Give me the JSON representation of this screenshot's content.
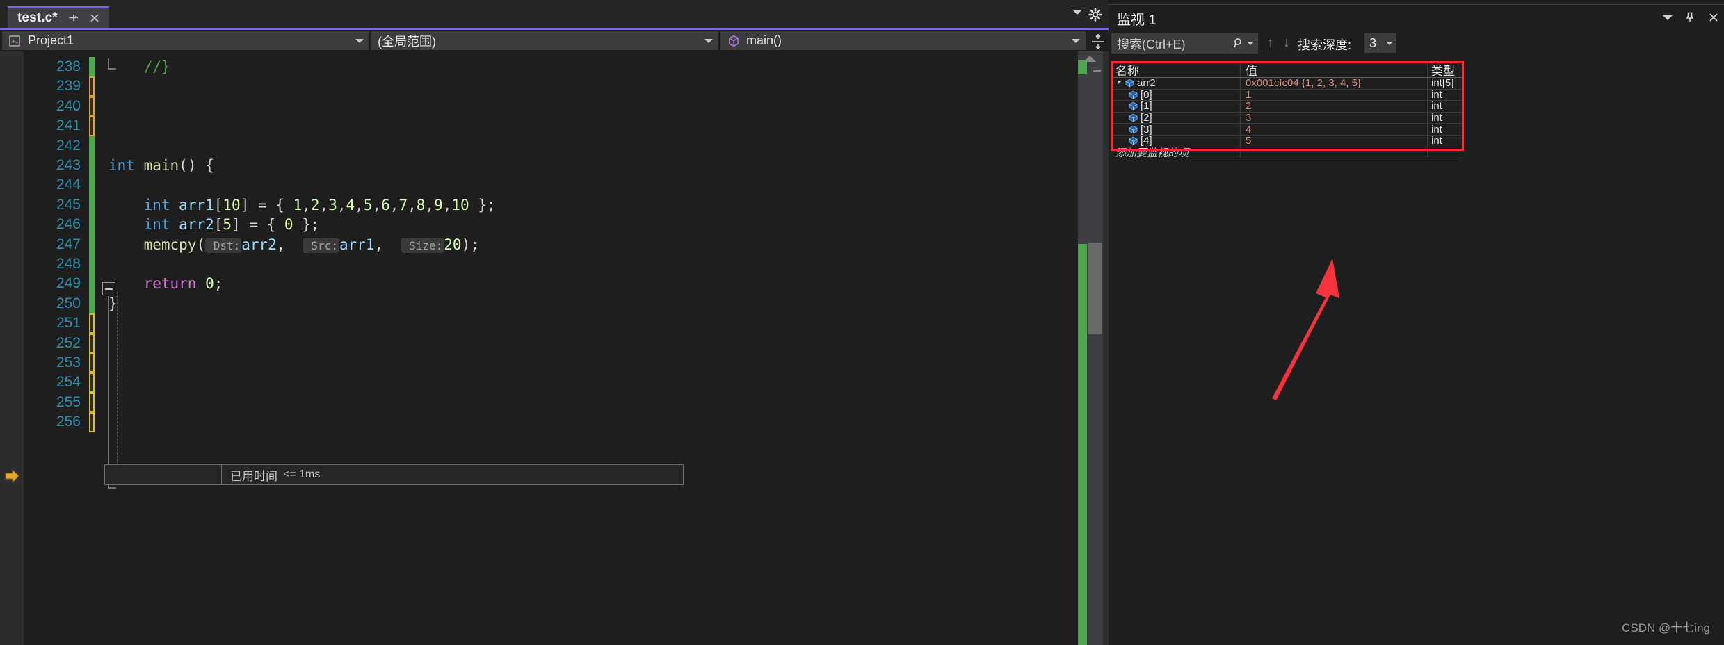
{
  "editor": {
    "tab": {
      "title": "test.c*",
      "pin_icon": "pin-icon",
      "close_icon": "close-icon"
    },
    "tabstrip": {
      "caret_icon": "chevron-down-icon",
      "gear_icon": "gear-icon"
    },
    "nav": {
      "project": "Project1",
      "project_icon": "cpp-project-icon",
      "scope": "(全局范围)",
      "member": "main()",
      "member_icon": "method-cube-icon",
      "split_icon": "split-view-icon",
      "caret_icon": "chevron-down-icon"
    },
    "first_line_number": 238,
    "last_line_number": 256,
    "lines": [
      {
        "n": 238,
        "change": "green",
        "segments": [
          {
            "t": "    //}",
            "c": "c-cm"
          }
        ]
      },
      {
        "n": 239,
        "change": "orange",
        "segments": []
      },
      {
        "n": 240,
        "change": "orange",
        "segments": []
      },
      {
        "n": 241,
        "change": "orange",
        "segments": []
      },
      {
        "n": 242,
        "change": "green",
        "segments": []
      },
      {
        "n": 243,
        "change": "green",
        "segments": [
          {
            "t": "int",
            "c": "c-kw"
          },
          {
            "t": " ",
            "c": "c-punc"
          },
          {
            "t": "main",
            "c": "c-fn"
          },
          {
            "t": "() {",
            "c": "c-punc"
          }
        ]
      },
      {
        "n": 244,
        "change": "green",
        "segments": []
      },
      {
        "n": 245,
        "change": "green",
        "segments": [
          {
            "t": "    int",
            "c": "c-kw"
          },
          {
            "t": " ",
            "c": "c-punc"
          },
          {
            "t": "arr1",
            "c": "c-id"
          },
          {
            "t": "[",
            "c": "c-brk"
          },
          {
            "t": "10",
            "c": "c-num"
          },
          {
            "t": "] = { ",
            "c": "c-brk"
          },
          {
            "t": "1",
            "c": "c-num"
          },
          {
            "t": ",",
            "c": "c-punc"
          },
          {
            "t": "2",
            "c": "c-num"
          },
          {
            "t": ",",
            "c": "c-punc"
          },
          {
            "t": "3",
            "c": "c-num"
          },
          {
            "t": ",",
            "c": "c-punc"
          },
          {
            "t": "4",
            "c": "c-num"
          },
          {
            "t": ",",
            "c": "c-punc"
          },
          {
            "t": "5",
            "c": "c-num"
          },
          {
            "t": ",",
            "c": "c-punc"
          },
          {
            "t": "6",
            "c": "c-num"
          },
          {
            "t": ",",
            "c": "c-punc"
          },
          {
            "t": "7",
            "c": "c-num"
          },
          {
            "t": ",",
            "c": "c-punc"
          },
          {
            "t": "8",
            "c": "c-num"
          },
          {
            "t": ",",
            "c": "c-punc"
          },
          {
            "t": "9",
            "c": "c-num"
          },
          {
            "t": ",",
            "c": "c-punc"
          },
          {
            "t": "10",
            "c": "c-num"
          },
          {
            "t": " };",
            "c": "c-brk"
          }
        ]
      },
      {
        "n": 246,
        "change": "green",
        "segments": [
          {
            "t": "    int",
            "c": "c-kw"
          },
          {
            "t": " ",
            "c": "c-punc"
          },
          {
            "t": "arr2",
            "c": "c-id"
          },
          {
            "t": "[",
            "c": "c-brk"
          },
          {
            "t": "5",
            "c": "c-num"
          },
          {
            "t": "] = { ",
            "c": "c-brk"
          },
          {
            "t": "0",
            "c": "c-num"
          },
          {
            "t": " };",
            "c": "c-brk"
          }
        ]
      },
      {
        "n": 247,
        "change": "green",
        "segments": [
          {
            "t": "    memcpy",
            "c": "c-fn"
          },
          {
            "t": "(",
            "c": "c-punc"
          },
          {
            "t": "_Dst:",
            "c": "hint"
          },
          {
            "t": "arr2",
            "c": "c-id"
          },
          {
            "t": ",  ",
            "c": "c-punc"
          },
          {
            "t": "_Src:",
            "c": "hint"
          },
          {
            "t": "arr1",
            "c": "c-id"
          },
          {
            "t": ",  ",
            "c": "c-punc"
          },
          {
            "t": "_Size:",
            "c": "hint"
          },
          {
            "t": "20",
            "c": "c-num"
          },
          {
            "t": ");",
            "c": "c-punc"
          }
        ]
      },
      {
        "n": 248,
        "change": "green",
        "segments": []
      },
      {
        "n": 249,
        "change": "green",
        "current": true,
        "segments": [
          {
            "t": "    return",
            "c": "c-ret"
          },
          {
            "t": " ",
            "c": "c-punc"
          },
          {
            "t": "0",
            "c": "c-num"
          },
          {
            "t": ";",
            "c": "c-punc"
          }
        ]
      },
      {
        "n": 250,
        "change": "green",
        "segments": [
          {
            "t": "}",
            "c": "c-punc"
          }
        ]
      },
      {
        "n": 251,
        "change": "yellow",
        "segments": []
      },
      {
        "n": 252,
        "change": "yellow",
        "segments": []
      },
      {
        "n": 253,
        "change": "yellow",
        "segments": []
      },
      {
        "n": 254,
        "change": "yellow",
        "segments": []
      },
      {
        "n": 255,
        "change": "yellow",
        "segments": []
      },
      {
        "n": 256,
        "change": "yellow",
        "segments": []
      }
    ],
    "elapsed_label": "已用时间",
    "elapsed_value": "<= 1ms",
    "exec_arrow_icon": "current-statement-arrow-icon",
    "scrollbar": {
      "up_icon": "scroll-up-arrow-icon"
    }
  },
  "watch": {
    "title": "监视 1",
    "caret_icon": "chevron-down-icon",
    "pin_icon": "pin-icon",
    "close_icon": "close-icon",
    "search_placeholder": "搜索(Ctrl+E)",
    "search_icon": "search-icon",
    "prev_icon": "arrow-up-icon",
    "next_icon": "arrow-down-icon",
    "depth_label": "搜索深度:",
    "depth_value": "3",
    "columns": {
      "name": "名称",
      "value": "值",
      "type": "类型"
    },
    "rows": [
      {
        "name": "arr2",
        "value": "0x001cfc04 {1, 2, 3, 4, 5}",
        "type": "int[5]",
        "level": 0,
        "expanded": true
      },
      {
        "name": "[0]",
        "value": "1",
        "type": "int",
        "level": 1
      },
      {
        "name": "[1]",
        "value": "2",
        "type": "int",
        "level": 1
      },
      {
        "name": "[2]",
        "value": "3",
        "type": "int",
        "level": 1
      },
      {
        "name": "[3]",
        "value": "4",
        "type": "int",
        "level": 1
      },
      {
        "name": "[4]",
        "value": "5",
        "type": "int",
        "level": 1
      }
    ],
    "add_row_placeholder": "添加要监视的项",
    "highlight_color": "#ff2d2d"
  },
  "annotation": {
    "arrow_color": "#f5333f",
    "arrow_icon": "annotation-arrow-icon"
  },
  "watermark": "CSDN @十七ing"
}
